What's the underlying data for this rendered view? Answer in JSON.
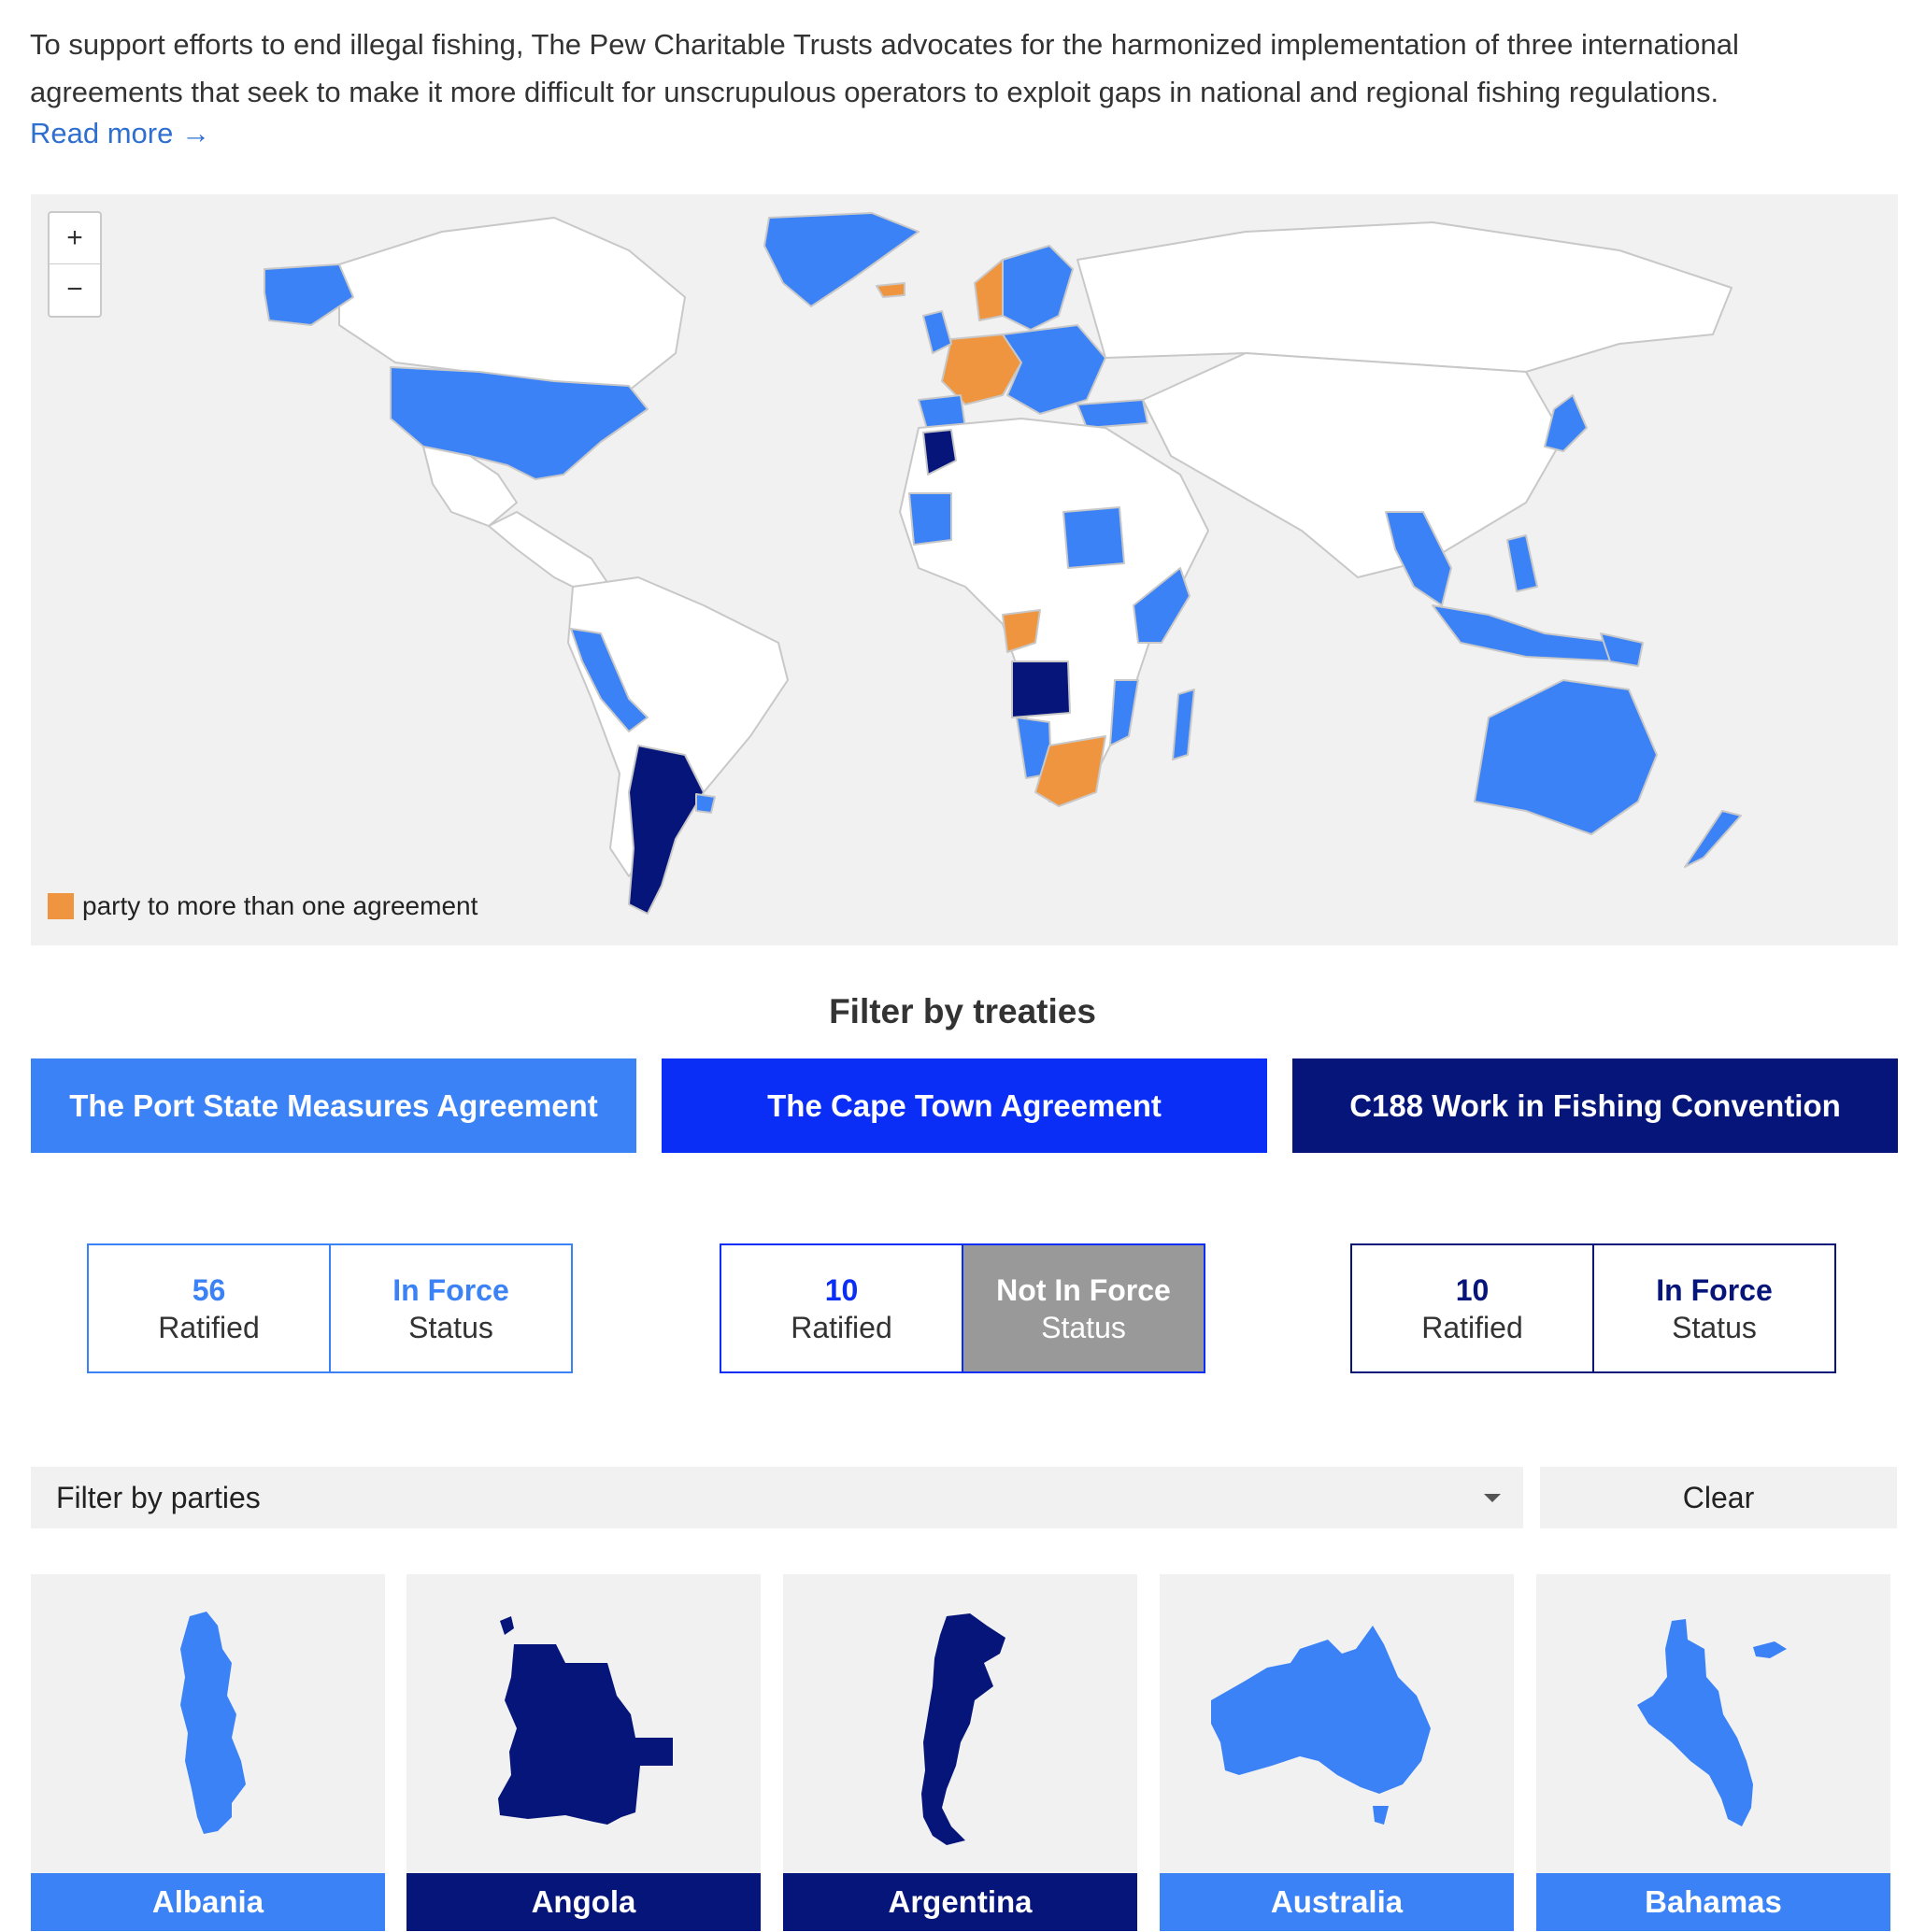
{
  "intro": {
    "text": "To support efforts to end illegal fishing, The Pew Charitable Trusts advocates for the harmonized implementation of three international agreements that seek to make it more difficult for unscrupulous operators to exploit gaps in national and regional fishing regulations.",
    "read_more": "Read more →"
  },
  "map": {
    "zoom_in": "+",
    "zoom_out": "−",
    "legend_label": "party to more than one agreement",
    "colors": {
      "psma": "#3b82f6",
      "c188": "#06157a",
      "multiple": "#f0953f",
      "none": "#ffffff",
      "ocean": "#f1f1f1"
    }
  },
  "filter_title": "Filter by treaties",
  "treaties": [
    {
      "label": "The Port State Measures Agreement",
      "color": "#3b82f6",
      "ratified": "56",
      "ratified_label": "Ratified",
      "status": "In Force",
      "status_label": "Status"
    },
    {
      "label": "The Cape Town Agreement",
      "color": "#0a2ef5",
      "ratified": "10",
      "ratified_label": "Ratified",
      "status": "Not In Force",
      "status_label": "Status"
    },
    {
      "label": "C188 Work in Fishing Convention",
      "color": "#06157a",
      "ratified": "10",
      "ratified_label": "Ratified",
      "status": "In Force",
      "status_label": "Status"
    }
  ],
  "party_filter": {
    "placeholder": "Filter by parties",
    "clear": "Clear"
  },
  "countries": [
    {
      "name": "Albania",
      "color": "#3b82f6"
    },
    {
      "name": "Angola",
      "color": "#06157a"
    },
    {
      "name": "Argentina",
      "color": "#06157a"
    },
    {
      "name": "Australia",
      "color": "#3b82f6"
    },
    {
      "name": "Bahamas",
      "color": "#3b82f6"
    }
  ]
}
